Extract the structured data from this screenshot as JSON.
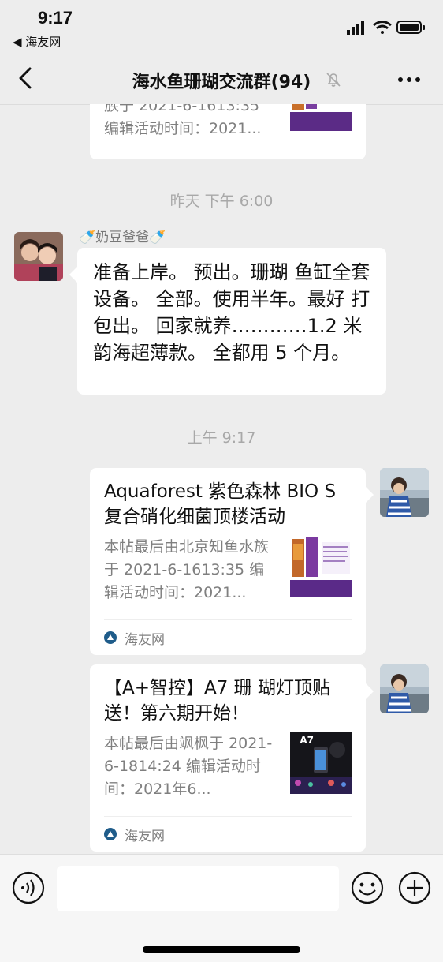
{
  "status_bar": {
    "time": "9:17",
    "back_app": "◀ 海友网"
  },
  "nav": {
    "title": "海水鱼珊瑚交流群(94)"
  },
  "chat": {
    "partial_top_card": {
      "desc_line1": "族于 2021-6-1613:35",
      "desc_line2": "编辑活动时间：2021..."
    },
    "timestamp1": "昨天 下午 6:00",
    "message1": {
      "sender": "🍼奶豆爸爸🍼",
      "text": "准备上岸。 预出。珊瑚 鱼缸全套设备。 全部。使用半年。最好 打包出。 回家就养…………1.2 米韵海超薄款。 全都用 5 个月。"
    },
    "timestamp2": "上午 9:17",
    "card1": {
      "title": "Aquaforest 紫色森林 BIO S 复合硝化细菌顶楼活动",
      "desc": "本帖最后由北京知鱼水族于 2021-6-1613:35 编辑活动时间：2021...",
      "source": "海友网"
    },
    "card2": {
      "title": "【A+智控】A7 珊 瑚灯顶贴送！第六期开始！",
      "desc": "本帖最后由飒枫于 2021-6-1814:24 编辑活动时间：2021年6...",
      "thumb_label": "A7",
      "source": "海友网"
    }
  },
  "colors": {
    "background": "#ededed",
    "bubble": "#ffffff",
    "timestamp": "#a8a8a8"
  }
}
